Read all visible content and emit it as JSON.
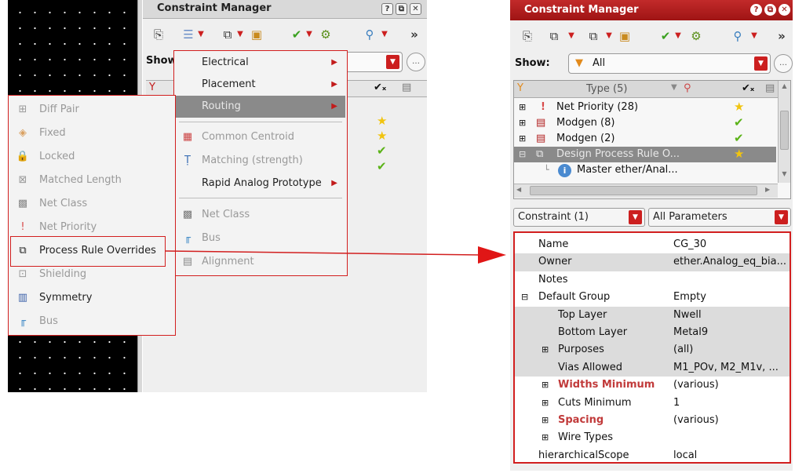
{
  "left_window": {
    "title": "Constraint Manager",
    "window_buttons": [
      "?",
      "⧉",
      "✕"
    ],
    "show_label": "Show"
  },
  "context_menu": {
    "items": [
      {
        "label": "Electrical",
        "submenu": true,
        "state": "normal"
      },
      {
        "label": "Placement",
        "submenu": true,
        "state": "normal"
      },
      {
        "label": "Routing",
        "submenu": true,
        "state": "highlighted"
      },
      {
        "label": "Common Centroid",
        "submenu": false,
        "state": "disabled"
      },
      {
        "label": "Matching (strength)",
        "submenu": false,
        "state": "disabled"
      },
      {
        "label": "Rapid Analog Prototype",
        "submenu": true,
        "state": "normal"
      },
      {
        "label": "Net Class",
        "submenu": false,
        "state": "disabled"
      },
      {
        "label": "Bus",
        "submenu": false,
        "state": "disabled"
      },
      {
        "label": "Alignment",
        "submenu": false,
        "state": "disabled"
      }
    ]
  },
  "object_menu": {
    "items": [
      {
        "label": "Diff Pair",
        "state": "disabled"
      },
      {
        "label": "Fixed",
        "state": "disabled"
      },
      {
        "label": "Locked",
        "state": "disabled"
      },
      {
        "label": "Matched Length",
        "state": "disabled"
      },
      {
        "label": "Net Class",
        "state": "disabled"
      },
      {
        "label": "Net Priority",
        "state": "disabled"
      },
      {
        "label": "Process Rule Overrides",
        "state": "highlighted"
      },
      {
        "label": "Shielding",
        "state": "disabled"
      },
      {
        "label": "Symmetry",
        "state": "normal"
      },
      {
        "label": "Bus",
        "state": "disabled"
      }
    ]
  },
  "right_window": {
    "title": "Constraint Manager",
    "window_buttons": [
      "?",
      "⧉",
      "✕"
    ],
    "show_label": "Show:",
    "show_value": "All",
    "tree_header": "Type (5)",
    "tree_rows": [
      {
        "label": "Net Priority (28)",
        "expander": "⊞",
        "icon": "!"
      },
      {
        "label": "Modgen (8)",
        "expander": "⊞",
        "icon": "▤"
      },
      {
        "label": "Modgen (2)",
        "expander": "⊞",
        "icon": "▤"
      },
      {
        "label": "Design Process Rule O...",
        "expander": "⊟",
        "icon": "⧉"
      },
      {
        "label": "Master ether/Anal...",
        "expander": "",
        "icon": "i"
      }
    ],
    "constraint_select": "Constraint (1)",
    "params_select": "All Parameters",
    "properties": [
      {
        "name": "Name",
        "value": "CG_30",
        "indent": 0,
        "expander": "",
        "emphasis": false,
        "alt": false
      },
      {
        "name": "Owner",
        "value": "ether.Analog_eq_bia...",
        "indent": 0,
        "expander": "",
        "emphasis": false,
        "alt": true
      },
      {
        "name": "Notes",
        "value": "",
        "indent": 0,
        "expander": "",
        "emphasis": false,
        "alt": false
      },
      {
        "name": "Default Group",
        "value": "Empty",
        "indent": 0,
        "expander": "⊟",
        "emphasis": false,
        "alt": false
      },
      {
        "name": "Top Layer",
        "value": "Nwell",
        "indent": 1,
        "expander": "",
        "emphasis": false,
        "alt": true
      },
      {
        "name": "Bottom Layer",
        "value": "Metal9",
        "indent": 1,
        "expander": "",
        "emphasis": false,
        "alt": true
      },
      {
        "name": "Purposes",
        "value": "(all)",
        "indent": 1,
        "expander": "⊞",
        "emphasis": false,
        "alt": true
      },
      {
        "name": "Vias Allowed",
        "value": "M1_POv, M2_M1v, ...",
        "indent": 1,
        "expander": "",
        "emphasis": false,
        "alt": true
      },
      {
        "name": "Widths Minimum",
        "value": "(various)",
        "indent": 1,
        "expander": "⊞",
        "emphasis": true,
        "alt": false
      },
      {
        "name": "Cuts Minimum",
        "value": "1",
        "indent": 1,
        "expander": "⊞",
        "emphasis": false,
        "alt": false
      },
      {
        "name": "Spacing",
        "value": "(various)",
        "indent": 1,
        "expander": "⊞",
        "emphasis": true,
        "alt": false
      },
      {
        "name": "Wire Types",
        "value": "",
        "indent": 1,
        "expander": "⊞",
        "emphasis": false,
        "alt": false
      },
      {
        "name": "hierarchicalScope",
        "value": "local",
        "indent": 0,
        "expander": "",
        "emphasis": false,
        "alt": false
      }
    ]
  },
  "colors": {
    "accent_red": "#d21f1f",
    "title_red": "#b01c1c",
    "highlight_gray": "#8a8a8a"
  }
}
